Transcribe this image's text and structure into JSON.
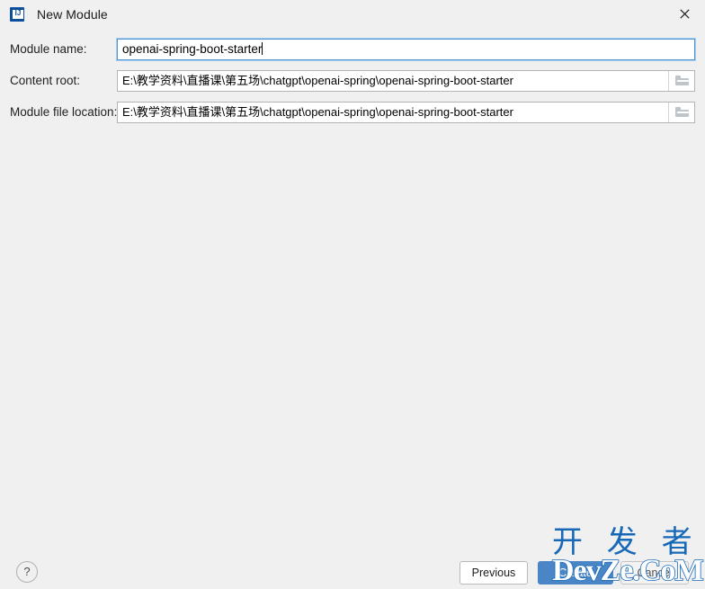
{
  "window": {
    "title": "New Module",
    "app_icon": "intellij-idea-icon",
    "icon_letters": "IJ",
    "close_icon": "close-icon",
    "background_color": "#f0f0f0"
  },
  "form": {
    "rows": [
      {
        "label": "Module name:",
        "value": "openai-spring-boot-starter",
        "focused": true,
        "has_browse": false
      },
      {
        "label": "Content root:",
        "value": "E:\\教学资料\\直播课\\第五场\\chatgpt\\openai-spring\\openai-spring-boot-starter",
        "focused": false,
        "has_browse": true,
        "browse_icon": "folder-icon"
      },
      {
        "label": "Module file location:",
        "value": "E:\\教学资料\\直播课\\第五场\\chatgpt\\openai-spring\\openai-spring-boot-starter",
        "focused": false,
        "has_browse": true,
        "browse_icon": "folder-icon"
      }
    ]
  },
  "footer": {
    "help_label": "?",
    "previous_label": "Previous",
    "create_label": "Create",
    "cancel_label": "Cancel",
    "accent_color": "#4a86c5"
  },
  "watermark": {
    "chinese": "开 发 者",
    "english": "DevZe.CoM",
    "color": "#1769b8"
  }
}
